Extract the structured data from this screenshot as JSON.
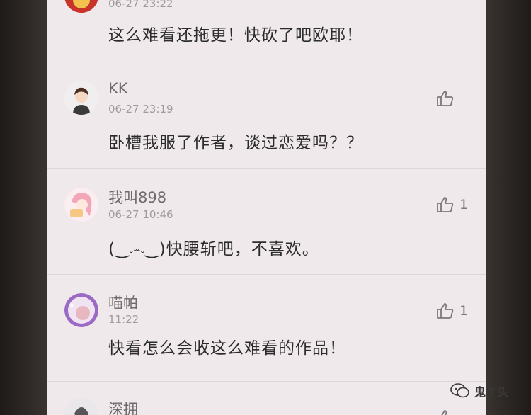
{
  "comments": [
    {
      "username": "",
      "time": "06-27 23:22",
      "text": "这么难看还拖更！快砍了吧欧耶！",
      "likes": ""
    },
    {
      "username": "KK",
      "time": "06-27 23:19",
      "text": "卧槽我服了作者，谈过恋爱吗？？",
      "likes": ""
    },
    {
      "username": "我叫898",
      "time": "06-27 10:46",
      "text": "(‿෴‿)快腰斩吧，不喜欢。",
      "likes": "1"
    },
    {
      "username": "喵帕",
      "time": "11:22",
      "text": "快看怎么会收这么难看的作品！",
      "likes": "1"
    },
    {
      "username": "深拥",
      "time": "",
      "text": "",
      "likes": ""
    }
  ],
  "icons": {
    "like": "thumbs-up-icon",
    "watermark": "wechat-icon"
  },
  "watermark": {
    "text": "鬼丫头"
  }
}
